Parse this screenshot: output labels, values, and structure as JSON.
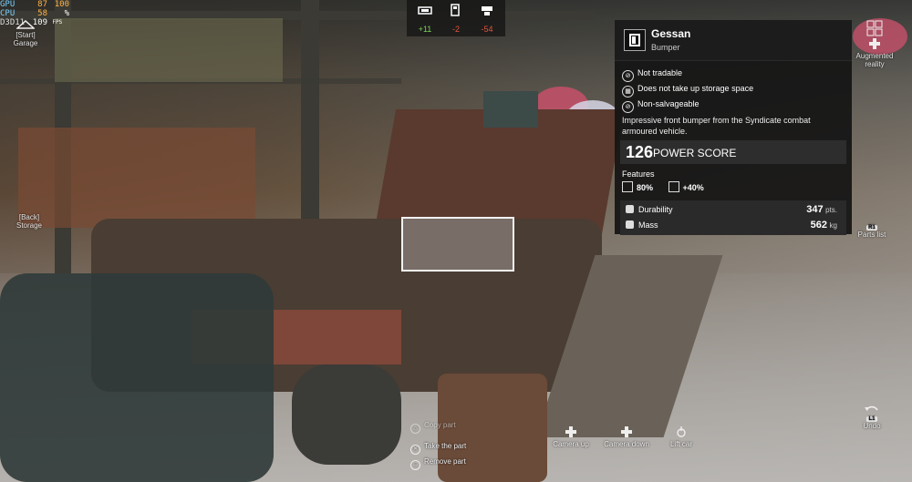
{
  "perf": {
    "rows": [
      {
        "key": "GPU",
        "v1": "87",
        "v2": "100"
      },
      {
        "key": "CPU",
        "v1": "58",
        "v2": "%"
      },
      {
        "key": "D3D11",
        "v1": "109",
        "v2": "FPS"
      }
    ]
  },
  "top_stats": [
    {
      "icon": "vehicle-icon",
      "value": "+11"
    },
    {
      "icon": "fuel-icon",
      "value": "-2"
    },
    {
      "icon": "weight-icon",
      "value": "-54"
    }
  ],
  "left_nav": {
    "garage": {
      "button": "[Start]",
      "label": "Garage"
    },
    "storage": {
      "button": "[Back]",
      "label": "Storage"
    }
  },
  "right_nav": {
    "ar": {
      "label": "Augmented reality"
    },
    "parts": {
      "button": "R1",
      "label": "Parts list"
    },
    "undo": {
      "button": "L1",
      "label": "Undo"
    }
  },
  "card": {
    "name": "Gessan",
    "category": "Bumper",
    "properties": [
      "Not tradable",
      "Does not take up storage space",
      "Non-salvageable"
    ],
    "description": "Impressive front bumper from the Syndicate combat armoured vehicle.",
    "power_score": "126",
    "power_label": "POWER SCORE",
    "features_title": "Features",
    "features": [
      {
        "icon": "resistance-icon",
        "value": "80%"
      },
      {
        "icon": "speed-icon",
        "value": "+40%"
      }
    ],
    "stats": [
      {
        "label": "Durability",
        "value": "347",
        "unit": "pts."
      },
      {
        "label": "Mass",
        "value": "562",
        "unit": "kg"
      }
    ]
  },
  "prompts": {
    "copy": "Copy part",
    "take": "Take the part",
    "remove": "Remove part",
    "camera_up": "Camera up",
    "camera_down": "Camera down",
    "lift": "Lift car"
  },
  "colors": {
    "positive": "#7cd15a",
    "negative": "#e0553a",
    "card_bg": "#141414"
  }
}
